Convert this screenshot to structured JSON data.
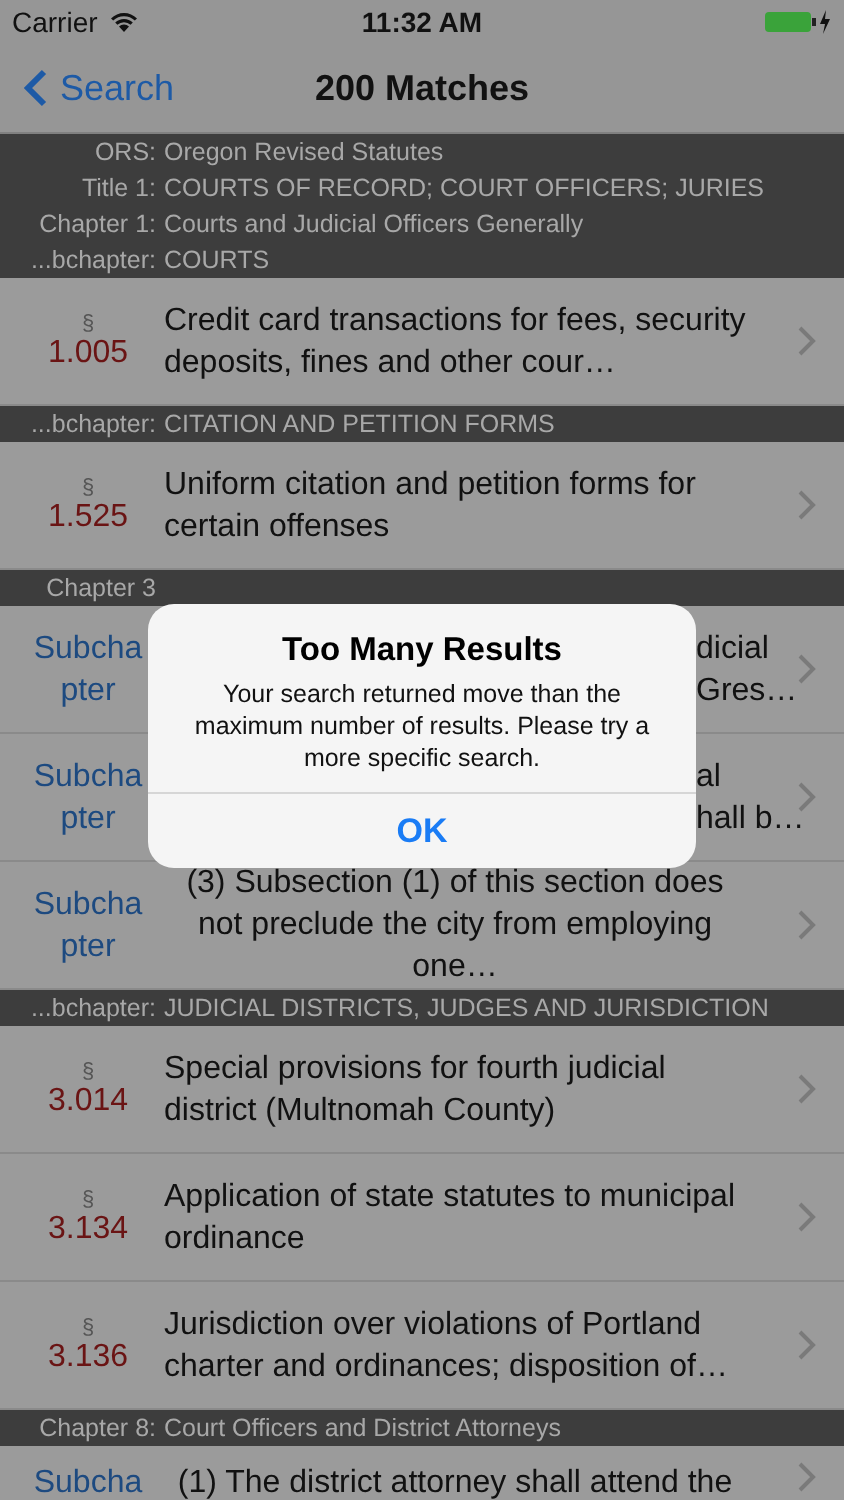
{
  "status_bar": {
    "carrier": "Carrier",
    "time": "11:32 AM"
  },
  "nav": {
    "back": "Search",
    "title": "200 Matches"
  },
  "results": [
    {
      "kind": "header",
      "lines": [
        {
          "label": "ORS:",
          "value": "Oregon Revised Statutes"
        },
        {
          "label": "Title 1:",
          "value": "COURTS OF RECORD; COURT OFFICERS; JURIES"
        },
        {
          "label": "Chapter 1:",
          "value": "Courts and Judicial Officers Generally"
        },
        {
          "label": "...bchapter:",
          "value": "COURTS"
        }
      ]
    },
    {
      "kind": "section",
      "symbol": "§",
      "number": "1.005",
      "text": "Credit card transactions for fees, security deposits, fines and other cour…"
    },
    {
      "kind": "header",
      "lines": [
        {
          "label": "...bchapter:",
          "value": "CITATION AND PETITION FORMS"
        }
      ]
    },
    {
      "kind": "section",
      "symbol": "§",
      "number": "1.525",
      "text": "Uniform citation and petition forms for certain offenses"
    },
    {
      "kind": "header",
      "lines": [
        {
          "label": "Chapter 3"
        }
      ]
    },
    {
      "kind": "subchapter",
      "label": "Subchapter",
      "lines": [
        "dicial",
        "Gres…"
      ]
    },
    {
      "kind": "subchapter",
      "label": "Subchapter",
      "lines": [
        "al",
        "hall b…"
      ]
    },
    {
      "kind": "subchapter",
      "label": "Subchapter",
      "text": "(3) Subsection (1) of this section does not preclude the city from employing one…"
    },
    {
      "kind": "header",
      "lines": [
        {
          "label": "...bchapter:",
          "value": "JUDICIAL DISTRICTS, JUDGES AND JURISDICTION"
        }
      ]
    },
    {
      "kind": "section",
      "symbol": "§",
      "number": "3.014",
      "text": "Special provisions for fourth judicial district (Multnomah County)"
    },
    {
      "kind": "section",
      "symbol": "§",
      "number": "3.134",
      "text": "Application of state statutes to municipal ordinance"
    },
    {
      "kind": "section",
      "symbol": "§",
      "number": "3.136",
      "text": "Jurisdiction over violations of Portland charter and ordinances; disposition of…"
    },
    {
      "kind": "header",
      "lines": [
        {
          "label": "Chapter 8:",
          "value": "Court Officers and District Attorneys"
        }
      ]
    },
    {
      "kind": "subchapter",
      "label": "Subcha",
      "text": "(1) The district attorney shall attend the"
    }
  ],
  "alert": {
    "title": "Too Many Results",
    "message": "Your search returned move than the maximum number of results. Please try a more specific search.",
    "button": "OK"
  }
}
